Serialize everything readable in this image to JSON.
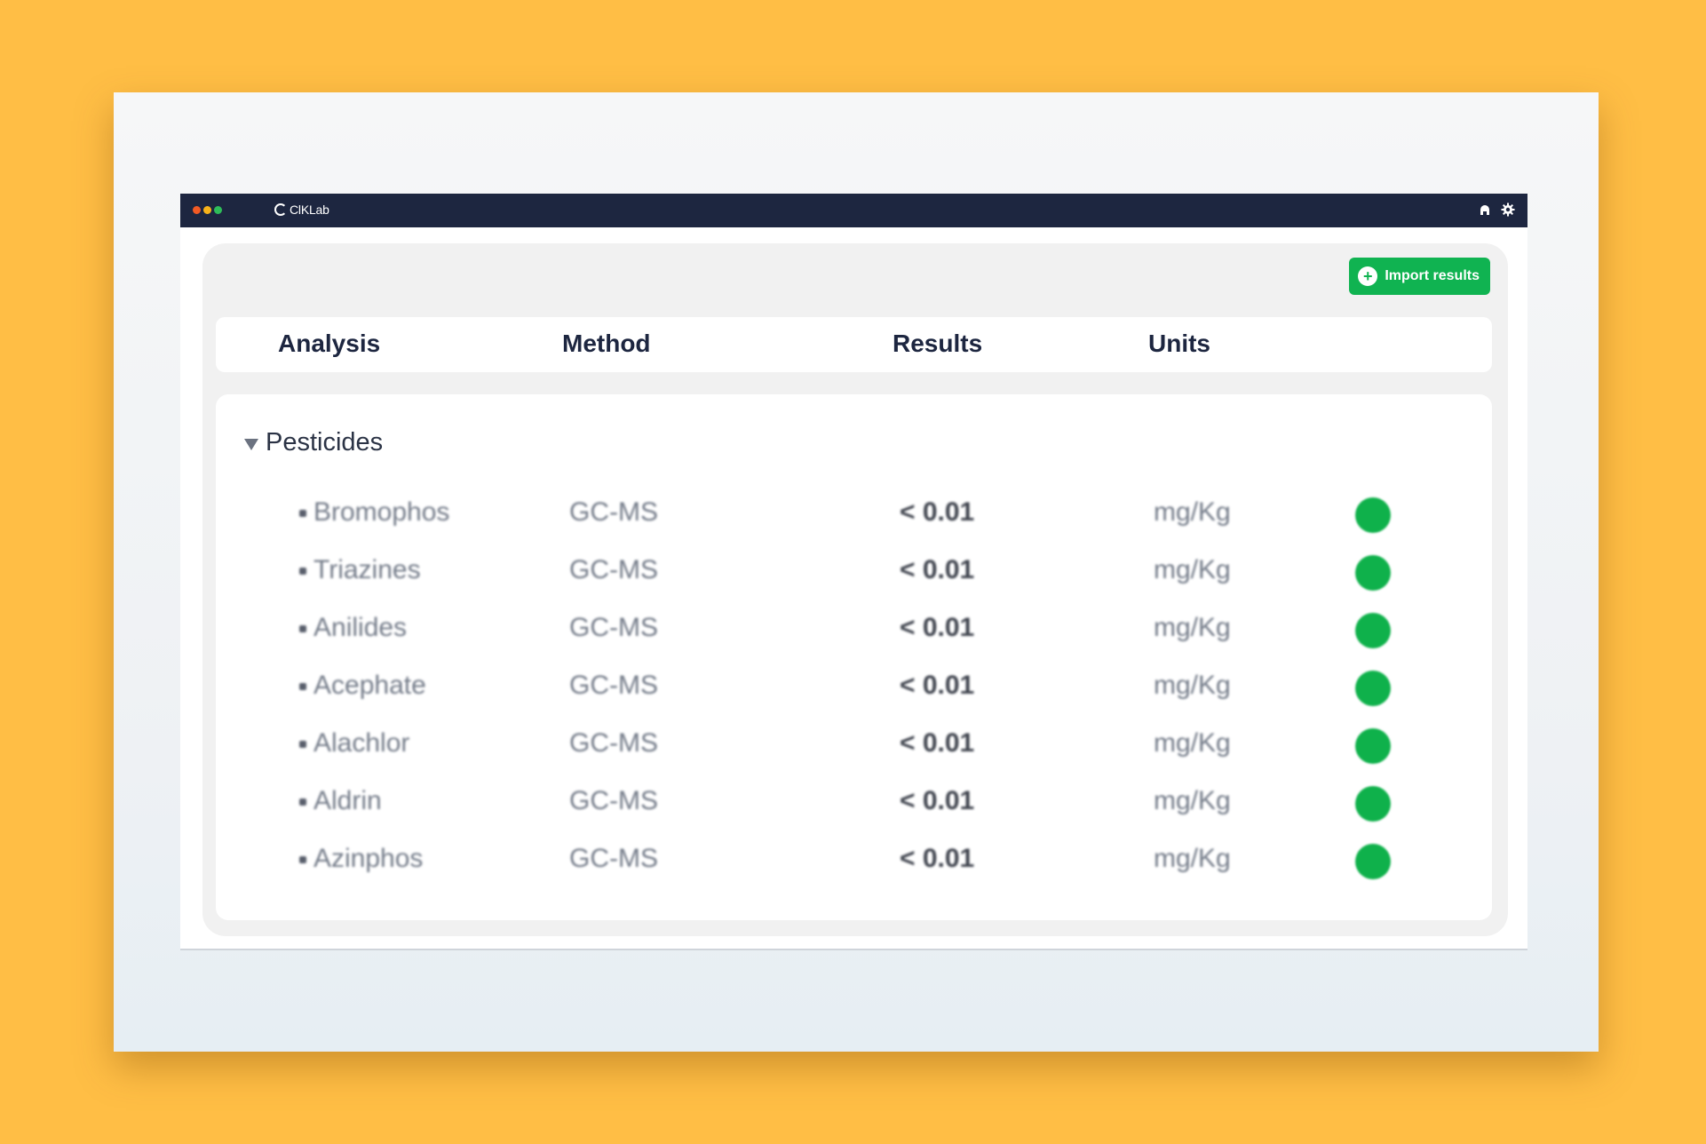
{
  "app": {
    "name": "ClKLab",
    "window_dots": [
      "#f15a24",
      "#f7b21a",
      "#2ebd59"
    ]
  },
  "toolbar": {
    "import_label": "Import results",
    "user_icon": "user-icon",
    "settings_icon": "gear-icon"
  },
  "table": {
    "headers": {
      "analysis": "Analysis",
      "method": "Method",
      "results": "Results",
      "units": "Units"
    },
    "group": "Pesticides",
    "rows": [
      {
        "analysis": "Bromophos",
        "method": "GC-MS",
        "result": "< 0.01",
        "unit": "mg/Kg",
        "status": "ok"
      },
      {
        "analysis": "Triazines",
        "method": "GC-MS",
        "result": "< 0.01",
        "unit": "mg/Kg",
        "status": "ok"
      },
      {
        "analysis": "Anilides",
        "method": "GC-MS",
        "result": "< 0.01",
        "unit": "mg/Kg",
        "status": "ok"
      },
      {
        "analysis": "Acephate",
        "method": "GC-MS",
        "result": "< 0.01",
        "unit": "mg/Kg",
        "status": "ok"
      },
      {
        "analysis": "Alachlor",
        "method": "GC-MS",
        "result": "< 0.01",
        "unit": "mg/Kg",
        "status": "ok"
      },
      {
        "analysis": "Aldrin",
        "method": "GC-MS",
        "result": "< 0.01",
        "unit": "mg/Kg",
        "status": "ok"
      },
      {
        "analysis": "Azinphos",
        "method": "GC-MS",
        "result": "< 0.01",
        "unit": "mg/Kg",
        "status": "ok"
      }
    ]
  },
  "colors": {
    "background": "#FFBE45",
    "titlebar": "#1d2640",
    "accent_green": "#10b351",
    "status_ok": "#0fb14b"
  }
}
